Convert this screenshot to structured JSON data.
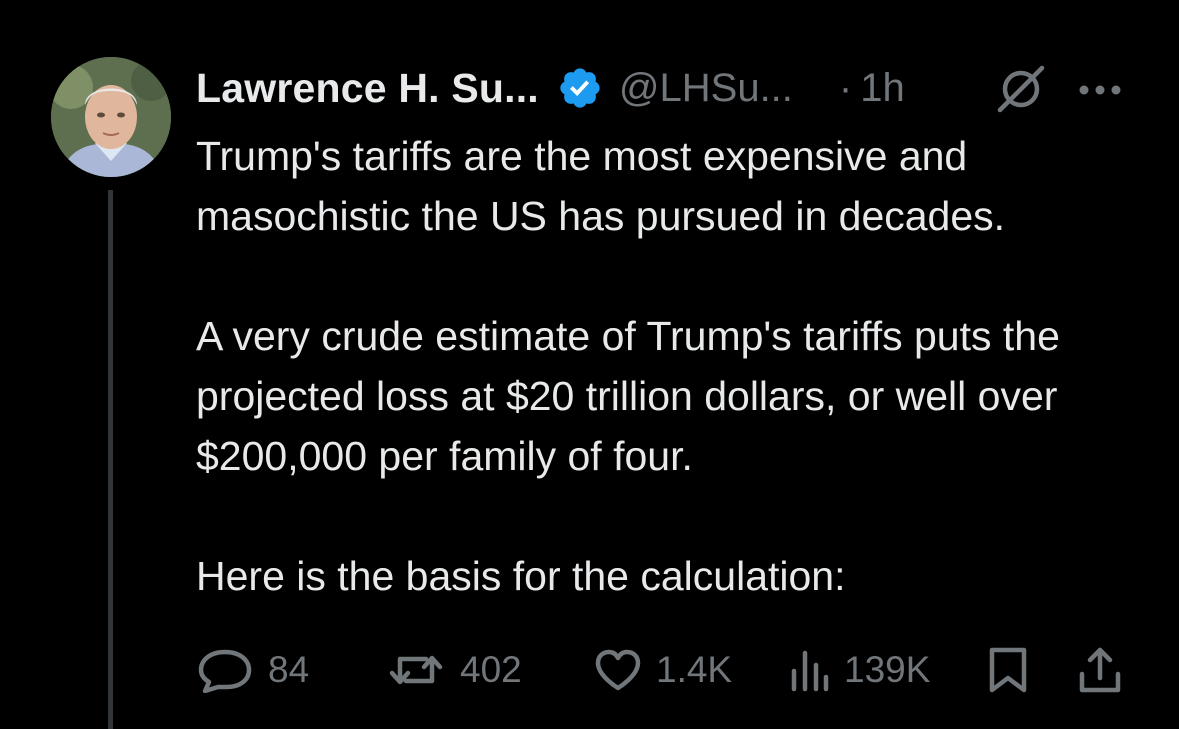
{
  "tweet": {
    "author_name": "Lawrence H. Su...",
    "handle": "@LHSu...",
    "separator": "·",
    "time": "1h",
    "paragraphs": [
      "Trump's tariffs are the most expensive and masochistic the US has pursued in decades.",
      "A very crude estimate of Trump's tariffs puts the projected loss at $20 trillion dollars, or well over $200,000 per family of four.",
      "Here is the basis for the calculation:"
    ]
  },
  "metrics": {
    "replies": "84",
    "reposts": "402",
    "likes": "1.4K",
    "views": "139K"
  },
  "icons": {
    "verified": "verified-badge-icon",
    "grok": "grok-icon",
    "more": "more-icon",
    "reply": "reply-icon",
    "repost": "repost-icon",
    "like": "like-icon",
    "views": "views-icon",
    "bookmark": "bookmark-icon",
    "share": "share-icon"
  },
  "colors": {
    "background": "#000000",
    "text_primary": "#e7e9ea",
    "text_secondary": "#71767b",
    "verified_blue": "#1d9bf0",
    "thread_line": "#333639"
  }
}
